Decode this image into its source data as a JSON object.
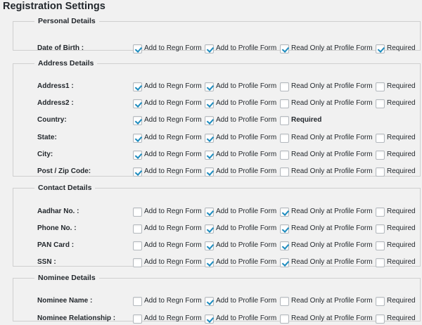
{
  "page_title": "Registration Settings",
  "sections": [
    {
      "legend": "Personal Details",
      "rows": [
        {
          "label": "Date of Birth :",
          "options": [
            {
              "text": "Add to Regn Form",
              "checked": true
            },
            {
              "text": "Add to Profile Form",
              "checked": true
            },
            {
              "text": "Read Only at Profile Form",
              "checked": true
            },
            {
              "text": "Required",
              "checked": true
            }
          ]
        }
      ]
    },
    {
      "legend": "Address Details",
      "rows": [
        {
          "label": "Address1 :",
          "options": [
            {
              "text": "Add to Regn Form",
              "checked": true
            },
            {
              "text": "Add to Profile Form",
              "checked": true
            },
            {
              "text": "Read Only at Profile Form",
              "checked": false
            },
            {
              "text": "Required",
              "checked": false
            }
          ]
        },
        {
          "label": "Address2 :",
          "options": [
            {
              "text": "Add to Regn Form",
              "checked": true
            },
            {
              "text": "Add to Profile Form",
              "checked": true
            },
            {
              "text": "Read Only at Profile Form",
              "checked": false
            },
            {
              "text": "Required",
              "checked": false
            }
          ]
        },
        {
          "label": "Country:",
          "options": [
            {
              "text": "Add to Regn Form",
              "checked": true
            },
            {
              "text": "Add to Profile Form",
              "checked": true
            },
            {
              "text": "Required",
              "checked": false
            }
          ]
        },
        {
          "label": "State:",
          "options": [
            {
              "text": "Add to Regn Form",
              "checked": true
            },
            {
              "text": "Add to Profile Form",
              "checked": true
            },
            {
              "text": "Read Only at Profile Form",
              "checked": false
            },
            {
              "text": "Required",
              "checked": false
            }
          ]
        },
        {
          "label": "City:",
          "options": [
            {
              "text": "Add to Regn Form",
              "checked": true
            },
            {
              "text": "Add to Profile Form",
              "checked": true
            },
            {
              "text": "Read Only at Profile Form",
              "checked": false
            },
            {
              "text": "Required",
              "checked": false
            }
          ]
        },
        {
          "label": "Post / Zip Code:",
          "options": [
            {
              "text": "Add to Regn Form",
              "checked": true
            },
            {
              "text": "Add to Profile Form",
              "checked": true
            },
            {
              "text": "Read Only at Profile Form",
              "checked": false
            },
            {
              "text": "Required",
              "checked": false
            }
          ]
        }
      ]
    },
    {
      "legend": "Contact Details",
      "rows": [
        {
          "label": "Aadhar No. :",
          "options": [
            {
              "text": "Add to Regn Form",
              "checked": false
            },
            {
              "text": "Add to Profile Form",
              "checked": true
            },
            {
              "text": "Read Only at Profile Form",
              "checked": true
            },
            {
              "text": "Required",
              "checked": false
            }
          ]
        },
        {
          "label": "Phone No. :",
          "options": [
            {
              "text": "Add to Regn Form",
              "checked": false
            },
            {
              "text": "Add to Profile Form",
              "checked": true
            },
            {
              "text": "Read Only at Profile Form",
              "checked": true
            },
            {
              "text": "Required",
              "checked": false
            }
          ]
        },
        {
          "label": "PAN Card :",
          "options": [
            {
              "text": "Add to Regn Form",
              "checked": false
            },
            {
              "text": "Add to Profile Form",
              "checked": true
            },
            {
              "text": "Read Only at Profile Form",
              "checked": true
            },
            {
              "text": "Required",
              "checked": false
            }
          ]
        },
        {
          "label": "SSN :",
          "options": [
            {
              "text": "Add to Regn Form",
              "checked": false
            },
            {
              "text": "Add to Profile Form",
              "checked": true
            },
            {
              "text": "Read Only at Profile Form",
              "checked": true
            },
            {
              "text": "Required",
              "checked": false
            }
          ]
        }
      ]
    },
    {
      "legend": "Nominee Details",
      "rows": [
        {
          "label": "Nominee Name :",
          "options": [
            {
              "text": "Add to Regn Form",
              "checked": false
            },
            {
              "text": "Add to Profile Form",
              "checked": true
            },
            {
              "text": "Read Only at Profile Form",
              "checked": false
            },
            {
              "text": "Required",
              "checked": false
            }
          ]
        },
        {
          "label": "Nominee Relationship :",
          "options": [
            {
              "text": "Add to Regn Form",
              "checked": false
            },
            {
              "text": "Add to Profile Form",
              "checked": true
            },
            {
              "text": "Read Only at Profile Form",
              "checked": false
            },
            {
              "text": "Required",
              "checked": false
            }
          ]
        }
      ]
    }
  ]
}
